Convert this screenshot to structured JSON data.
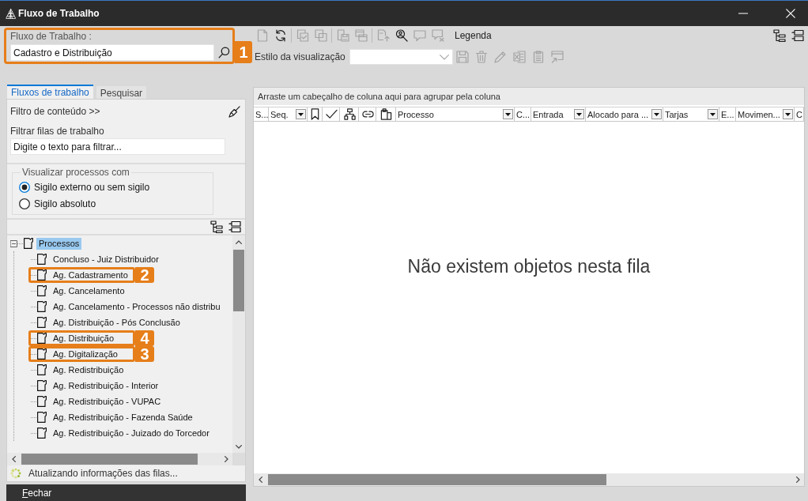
{
  "window": {
    "title": "Fluxo de Trabalho"
  },
  "workflow": {
    "label": "Fluxo de Trabalho :",
    "value": "Cadastro e Distribuição",
    "callout": "1"
  },
  "toolbar": {
    "tools": [
      {
        "disabled": true
      },
      {
        "disabled": false
      },
      {
        "disabled": true
      },
      {
        "disabled": true
      },
      {
        "disabled": true
      },
      {
        "disabled": true
      },
      {
        "disabled": true
      },
      {
        "disabled": false
      },
      {
        "disabled": true
      },
      {
        "disabled": true
      }
    ],
    "legend": "Legenda"
  },
  "view_style": {
    "label": "Estilo da visualização",
    "tools": [
      {
        "disabled": true
      },
      {
        "disabled": true
      },
      {
        "disabled": true
      },
      {
        "disabled": true
      },
      {
        "disabled": true
      },
      {
        "disabled": true
      }
    ]
  },
  "tabs": [
    {
      "label": "Fluxos de trabalho",
      "selected": true
    },
    {
      "label": "Pesquisar",
      "selected": false
    }
  ],
  "filter": {
    "toggle": "Filtro de conteúdo >>",
    "label": "Filtrar filas de trabalho",
    "placeholder": "Digite o texto para filtrar..."
  },
  "visibility": {
    "legend": "Visualizar processos com",
    "options": [
      {
        "label": "Sigilo externo ou sem sigilo",
        "selected": true
      },
      {
        "label": "Sigilo absoluto",
        "selected": false
      }
    ]
  },
  "tree": [
    {
      "label": "Processos",
      "expanded": true,
      "selected": true,
      "children": [
        {
          "label": "Concluso - Juiz Distribuidor",
          "selected": false
        },
        {
          "label": "Ag. Cadastramento",
          "selected": false,
          "callout": "2"
        },
        {
          "label": "Ag. Cancelamento",
          "selected": false
        },
        {
          "label": "Ag. Cancelamento - Processos não distribu",
          "selected": false
        },
        {
          "label": "Ag. Distribuição - Pós Conclusão",
          "selected": false
        },
        {
          "label": "Ag. Distribuição",
          "selected": false,
          "callout": "4"
        },
        {
          "label": "Ag. Digitalização",
          "selected": false,
          "callout": "3"
        },
        {
          "label": "Ag. Redistribuição",
          "selected": false
        },
        {
          "label": "Ag. Redistribuição - Interior",
          "selected": false
        },
        {
          "label": "Ag. Redistribuição - VUPAC",
          "selected": false
        },
        {
          "label": "Ag. Redistribuição - Fazenda Saúde",
          "selected": false
        },
        {
          "label": "Ag. Redistribuição - Juizado do Torcedor",
          "selected": false
        }
      ]
    }
  ],
  "status": "Atualizando informações das filas...",
  "close_button": "Fechar",
  "grid": {
    "group_hint": "Arraste um cabeçalho de coluna aqui para agrupar pela coluna",
    "columns": [
      {
        "kind": "text",
        "label": "S...",
        "filter": false
      },
      {
        "kind": "text",
        "label": "Seq.",
        "filter": true
      },
      {
        "kind": "icon"
      },
      {
        "kind": "icon"
      },
      {
        "kind": "icon"
      },
      {
        "kind": "icon"
      },
      {
        "kind": "icon"
      },
      {
        "kind": "text",
        "label": "Processo",
        "filter": true
      },
      {
        "kind": "text",
        "label": "C...",
        "filter": false
      },
      {
        "kind": "text",
        "label": "Entrada",
        "filter": true
      },
      {
        "kind": "text",
        "label": "Alocado para ...",
        "filter": true
      },
      {
        "kind": "text",
        "label": "Tarjas",
        "filter": true
      },
      {
        "kind": "text",
        "label": "E...",
        "filter": false
      },
      {
        "kind": "text",
        "label": "Movimen...",
        "filter": true
      },
      {
        "kind": "text",
        "label": "C",
        "filter": false
      }
    ],
    "empty_message": "Não existem objetos nesta fila"
  }
}
